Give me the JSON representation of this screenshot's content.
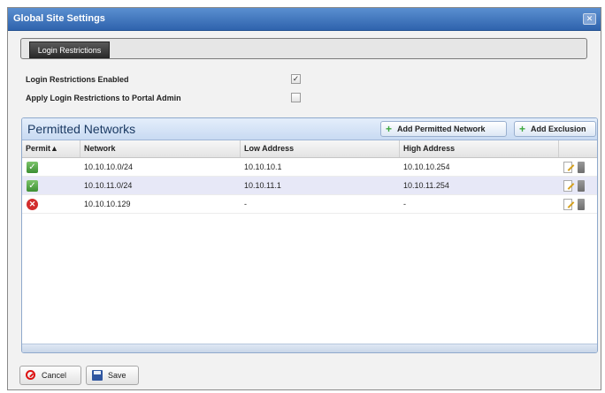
{
  "dialog": {
    "title": "Global Site Settings",
    "close_glyph": "✕"
  },
  "tabs": [
    {
      "label": "Login Restrictions",
      "selected": true
    }
  ],
  "options": [
    {
      "label": "Login Restrictions Enabled",
      "checked": true
    },
    {
      "label": "Apply Login Restrictions to Portal Admin",
      "checked": false
    }
  ],
  "panel": {
    "title": "Permitted Networks",
    "add_permitted_label": "Add Permitted Network",
    "add_exclusion_label": "Add Exclusion",
    "columns": [
      "Permit▲",
      "Network",
      "Low Address",
      "High Address"
    ],
    "rows": [
      {
        "permit": true,
        "network": "10.10.10.0/24",
        "low": "10.10.10.1",
        "high": "10.10.10.254"
      },
      {
        "permit": true,
        "network": "10.10.11.0/24",
        "low": "10.10.11.1",
        "high": "10.10.11.254"
      },
      {
        "permit": false,
        "network": "10.10.10.129",
        "low": "-",
        "high": "-"
      }
    ]
  },
  "footer": {
    "cancel_label": "Cancel",
    "save_label": "Save"
  },
  "colors": {
    "titlebar": "#3a6fb8",
    "selected_row": "#e7e8f7",
    "permit_green": "#4a9c3c",
    "deny_red": "#d22d2d"
  },
  "icons": {
    "permit_true": "checkmark-icon",
    "permit_false": "deny-icon",
    "add": "plus-icon",
    "row_edit": "edit-icon",
    "row_delete": "delete-icon"
  }
}
